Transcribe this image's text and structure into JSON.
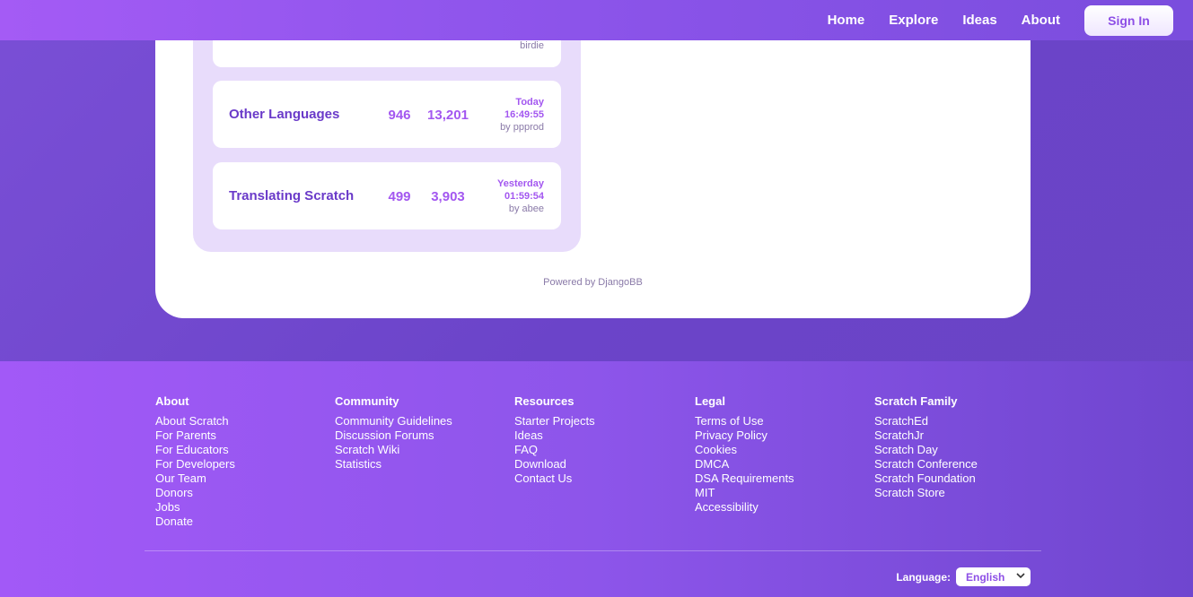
{
  "nav": {
    "links": [
      "Home",
      "Explore",
      "Ideas",
      "About"
    ],
    "signin": "Sign In"
  },
  "forum": {
    "partial_row": {
      "by": "birdie"
    },
    "rows": [
      {
        "name": "Other Languages",
        "topics": "946",
        "posts": "13,201",
        "date_line1": "Today",
        "date_line2": "16:49:55",
        "by": "by ppprod"
      },
      {
        "name": "Translating Scratch",
        "topics": "499",
        "posts": "3,903",
        "date_line1": "Yesterday",
        "date_line2": "01:59:54",
        "by": "by abee"
      }
    ],
    "powered_by": "Powered by DjangoBB"
  },
  "footer": {
    "columns": [
      {
        "heading": "About",
        "links": [
          "About Scratch",
          "For Parents",
          "For Educators",
          "For Developers",
          "Our Team",
          "Donors",
          "Jobs",
          "Donate"
        ]
      },
      {
        "heading": "Community",
        "links": [
          "Community Guidelines",
          "Discussion Forums",
          "Scratch Wiki",
          "Statistics"
        ]
      },
      {
        "heading": "Resources",
        "links": [
          "Starter Projects",
          "Ideas",
          "FAQ",
          "Download",
          "Contact Us"
        ]
      },
      {
        "heading": "Legal",
        "links": [
          "Terms of Use",
          "Privacy Policy",
          "Cookies",
          "DMCA",
          "DSA Requirements",
          "MIT",
          "Accessibility"
        ]
      },
      {
        "heading": "Scratch Family",
        "links": [
          "ScratchEd",
          "ScratchJr",
          "Scratch Day",
          "Scratch Conference",
          "Scratch Foundation",
          "Scratch Store"
        ]
      }
    ],
    "language_label": "Language:",
    "language_value": "English"
  },
  "colors": {
    "accent": "#a357f0",
    "brand_purple": "#855cd6",
    "footer_start": "#a259f7"
  },
  "icons": {
    "language_select": "chevron-down-icon"
  }
}
